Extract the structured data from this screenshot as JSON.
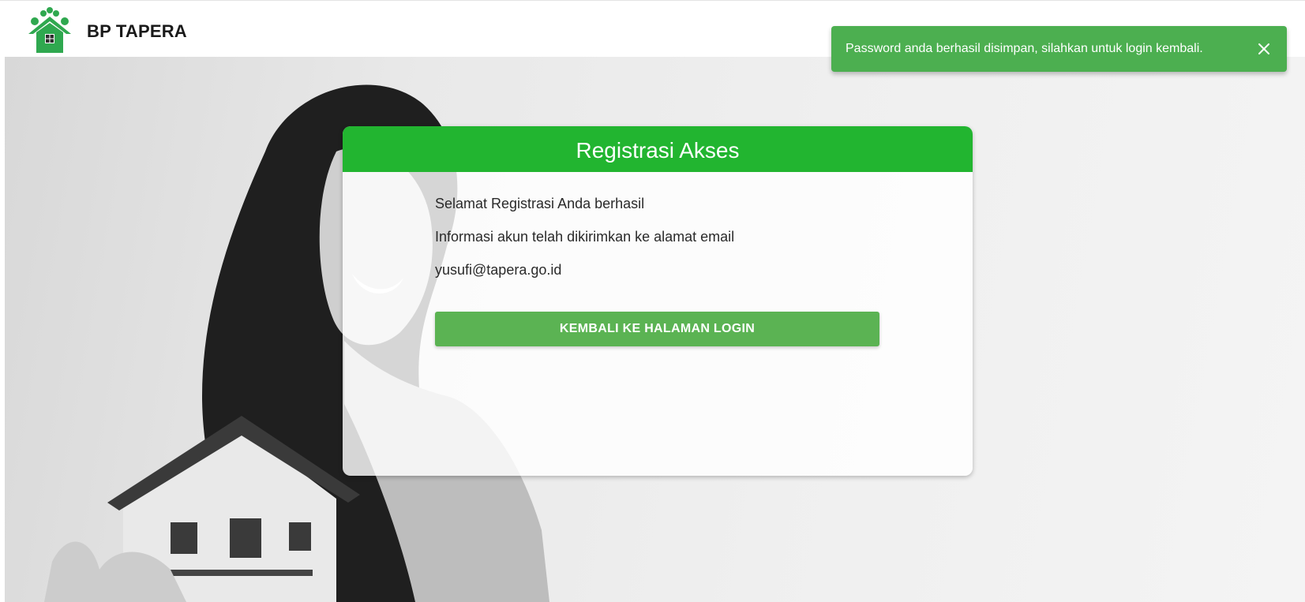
{
  "header": {
    "brand": "BP TAPERA"
  },
  "toast": {
    "message": "Password anda berhasil disimpan, silahkan untuk login kembali.",
    "close_icon": "close-icon",
    "color": "#4caf50"
  },
  "card": {
    "title": "Registrasi Akses",
    "line1": "Selamat Registrasi Anda berhasil",
    "line2": "Informasi akun telah dikirimkan ke alamat email",
    "email": "yusufi@tapera.go.id",
    "button_label": "KEMBALI KE HALAMAN LOGIN",
    "accent": "#22b530"
  }
}
